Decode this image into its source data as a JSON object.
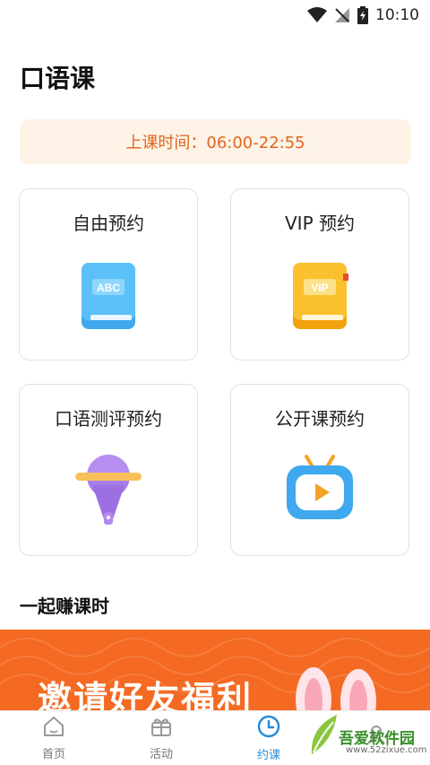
{
  "status_bar": {
    "time": "10:10"
  },
  "page": {
    "title": "口语课"
  },
  "schedule": {
    "text": "上课时间：06:00-22:55"
  },
  "cards": [
    {
      "label": "自由预约",
      "icon": "abc-book-icon",
      "art_text": "ABC"
    },
    {
      "label": "VIP 预约",
      "icon": "vip-book-icon",
      "art_text": "VIP"
    },
    {
      "label": "口语测评预约",
      "icon": "microphone-icon"
    },
    {
      "label": "公开课预约",
      "icon": "tv-play-icon"
    }
  ],
  "section": {
    "title": "一起赚课时"
  },
  "banner": {
    "text": "邀请好友福利"
  },
  "tabs": [
    {
      "label": "首页",
      "icon": "home-icon",
      "active": false
    },
    {
      "label": "活动",
      "icon": "gift-icon",
      "active": false
    },
    {
      "label": "约课",
      "icon": "clock-icon",
      "active": true
    },
    {
      "label": "",
      "icon": "profile-icon",
      "active": false
    }
  ],
  "watermark": {
    "text": "吾爱软件园",
    "url": "www.52zixue.com"
  },
  "colors": {
    "accent": "#2a8cd8",
    "orange": "#e0661f",
    "banner": "#f46a22"
  }
}
